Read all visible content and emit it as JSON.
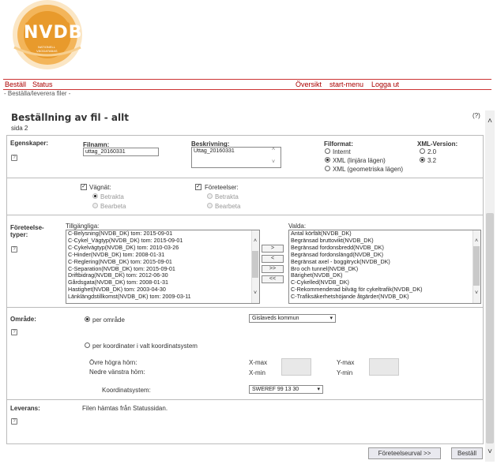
{
  "logo": {
    "text": "NVDB",
    "sub1": "NATIONELL",
    "sub2": "VÄGDATABAS"
  },
  "nav": {
    "order": "Beställ",
    "status": "Status",
    "overview": "Översikt",
    "start_menu": "start-menu",
    "logout": "Logga ut"
  },
  "breadcrumb": "- Beställa/leverera filer -",
  "page": {
    "title": "Beställning av fil - allt",
    "subtitle": "sida 2",
    "help": "(?)"
  },
  "props": {
    "label": "Egenskaper:",
    "filename_label": "Filnamn:",
    "filename_value": "uttag_20160331",
    "desc_label": "Beskrivning:",
    "desc_value": "Uttag_20160331",
    "format_label": "Filformat:",
    "format_options": [
      "Internt",
      "XML (linjära lägen)",
      "XML (geometriska lägen)"
    ],
    "format_selected": 1,
    "version_label": "XML-Version:",
    "version_options": [
      "2.0",
      "3.2"
    ],
    "version_selected": 1
  },
  "network": {
    "vagnat_label": "Vägnät:",
    "vagnat_checked": true,
    "vagnat_options": [
      "Betrakta",
      "Bearbeta"
    ],
    "foreteelser_label": "Företeelser:",
    "foreteelser_checked": true,
    "foreteelser_options": [
      "Betrakta",
      "Bearbeta"
    ]
  },
  "types": {
    "label_line1": "Företeelse-",
    "label_line2": "typer:",
    "available_label": "Tillgängliga:",
    "available": [
      "C-Belysning(NVDB_DK) tom: 2015-09-01",
      "C-Cykel_Vägtyp(NVDB_DK) tom: 2015-09-01",
      "C-Cykelvägtyp(NVDB_DK) tom: 2010-03-26",
      "C-Hinder(NVDB_DK) tom: 2008-01-31",
      "C-Reglering(NVDB_DK) tom: 2015-09-01",
      "C-Separation(NVDB_DK) tom: 2015-09-01",
      "Driftbidrag(NVDB_DK) tom: 2012-06-30",
      "Gårdsgata(NVDB_DK) tom: 2008-01-31",
      "Hastighet(NVDB_DK) tom: 2003-04-30",
      "Länklängdstillkomst(NVDB_DK) tom: 2009-03-11"
    ],
    "selected_label": "Valda:",
    "selected": [
      "Antal körfält(NVDB_DK)",
      "Begränsad bruttovikt(NVDB_DK)",
      "Begränsad fordonsbredd(NVDB_DK)",
      "Begränsad fordonslängd(NVDB_DK)",
      "Begränsat axel - boggitryck(NVDB_DK)",
      "Bro och tunnel(NVDB_DK)",
      "Bärighet(NVDB_DK)",
      "C-Cykelled(NVDB_DK)",
      "C-Rekommenderad bilväg för cykeltrafik(NVDB_DK)",
      "C-Trafiksäkerhetshöjande åtgärder(NVDB_DK)"
    ],
    "move_buttons": [
      ">",
      "<",
      ">>",
      "<<"
    ]
  },
  "area": {
    "label": "Område:",
    "per_area_label": "per område",
    "per_area_selected": true,
    "municipality": "Gislaveds kommun",
    "per_coord_label": "per koordinater i valt koordinatsystem",
    "upper_right": "Övre högra hörn:",
    "lower_left": "Nedre vänstra hörn:",
    "xmax": "X-max",
    "ymax": "Y-max",
    "xmin": "X-min",
    "ymin": "Y-min",
    "crs_label": "Koordinatsystem:",
    "crs_value": "SWEREF 99 13 30"
  },
  "delivery": {
    "label": "Leverans:",
    "text": "Filen hämtas från Statussidan."
  },
  "footer": {
    "back_button": "Företeelseurval >>",
    "order_button": "Beställ"
  },
  "colors": {
    "nav_text": "#aa0000",
    "nav_border": "#cc3333",
    "logo_orange": "#e89a2c"
  }
}
